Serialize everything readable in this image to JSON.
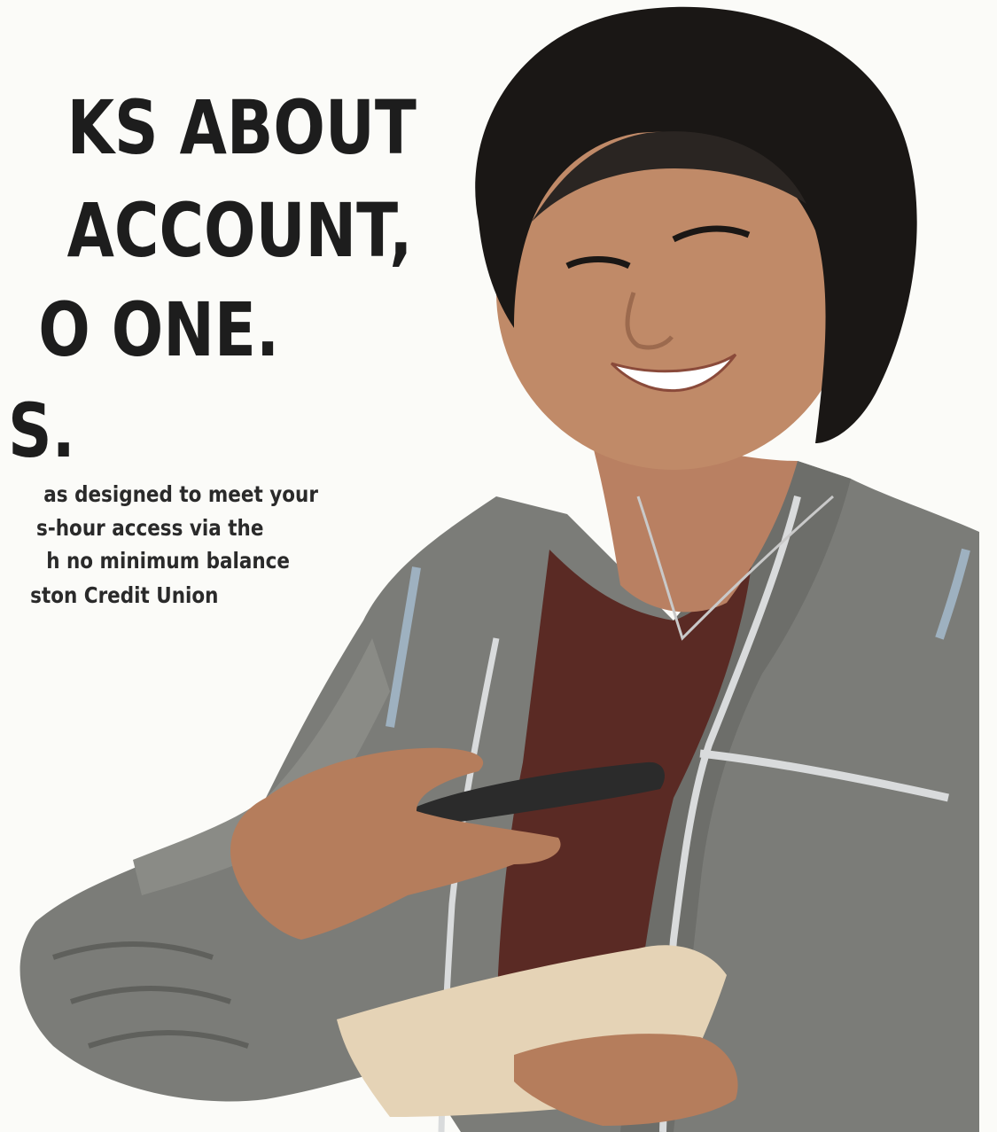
{
  "ad": {
    "headline": [
      "KS ABOUT",
      "ACCOUNT,",
      "O ONE.",
      "S."
    ],
    "body": [
      "as designed to meet your",
      "s-hour access via the",
      "h no minimum balance",
      "ston Credit Union"
    ]
  },
  "colors": {
    "background": "#fbfbf8",
    "text": "#1d1d1d",
    "jacket": "#7b7c78",
    "hair": "#1a1715",
    "skin": "#c08a68",
    "shirt": "#5a2a24"
  }
}
